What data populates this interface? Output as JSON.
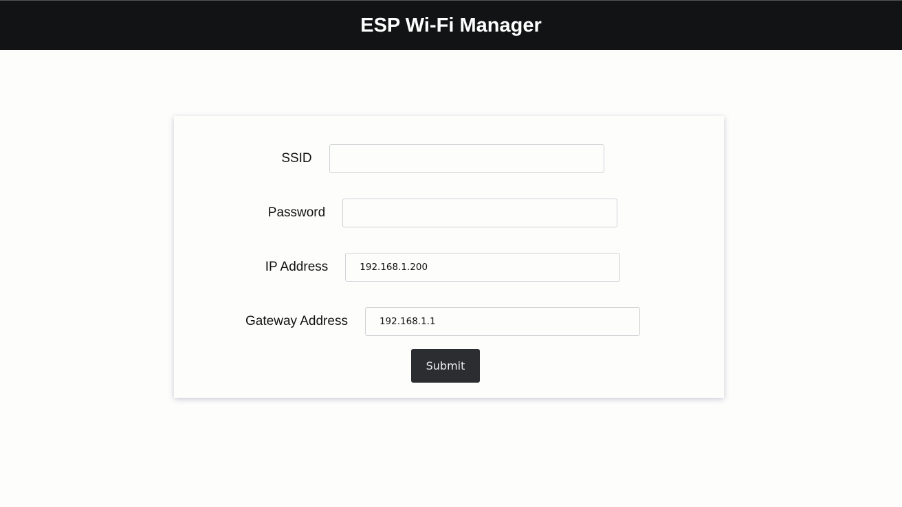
{
  "header": {
    "title": "ESP Wi-Fi Manager"
  },
  "form": {
    "fields": [
      {
        "label": "SSID",
        "value": ""
      },
      {
        "label": "Password",
        "value": ""
      },
      {
        "label": "IP Address",
        "value": "192.168.1.200"
      },
      {
        "label": "Gateway Address",
        "value": "192.168.1.1"
      }
    ],
    "submit_label": "Submit"
  }
}
